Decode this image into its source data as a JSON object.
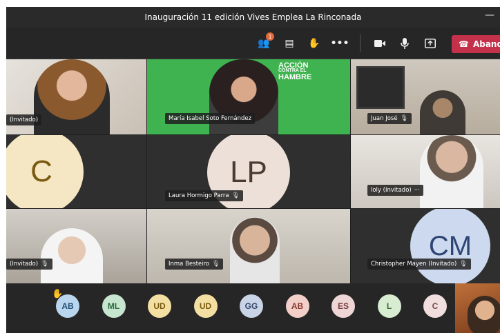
{
  "window": {
    "title": "Inauguración 11 edición Vives Emplea La Rinconada"
  },
  "toolbar": {
    "participants_count": "1",
    "leave_label": "Abandonar"
  },
  "tiles": {
    "t1": {
      "name": "(Invitado)"
    },
    "t2": {
      "name": "María Isabel Soto Fernández",
      "brand_line1": "ACCIÓN",
      "brand_line2": "CONTRA EL",
      "brand_line3": "HAMBRE"
    },
    "t3": {
      "name": "Juan José"
    },
    "t4": {
      "initials": "C"
    },
    "t5": {
      "initials": "LP",
      "name": "Laura Hormigo Parra"
    },
    "t6": {
      "name": "loly (Invitado)",
      "more": "···"
    },
    "t7": {
      "name": "(Invitado)"
    },
    "t8": {
      "name": "Inma Besteiro"
    },
    "t9": {
      "initials": "CM",
      "name": "Christopher Mayen (Invitado)"
    }
  },
  "roster": [
    {
      "initials": "AB",
      "bg": "#b9d6ee",
      "fg": "#25507a",
      "hand": true
    },
    {
      "initials": "ML",
      "bg": "#c6e6cf",
      "fg": "#2f6b3e"
    },
    {
      "initials": "UD",
      "bg": "#f3dfa2",
      "fg": "#7a5a10"
    },
    {
      "initials": "UD",
      "bg": "#f3dfa2",
      "fg": "#7a5a10"
    },
    {
      "initials": "GG",
      "bg": "#c9d4e6",
      "fg": "#35486a"
    },
    {
      "initials": "AB",
      "bg": "#f2cfc9",
      "fg": "#8a3a2e"
    },
    {
      "initials": "ES",
      "bg": "#efd6d6",
      "fg": "#7a3f3f"
    },
    {
      "initials": "L",
      "bg": "#d7ecd0",
      "fg": "#3b6b2f"
    },
    {
      "initials": "C",
      "bg": "#f1dede",
      "fg": "#7a4a4a"
    }
  ],
  "colors": {
    "leave": "#c4314b",
    "accion_green": "#3fb34f",
    "avatar_cream": "#f5e6c4",
    "avatar_lp": "#ece0d8",
    "avatar_cm": "#cdd9ee"
  }
}
